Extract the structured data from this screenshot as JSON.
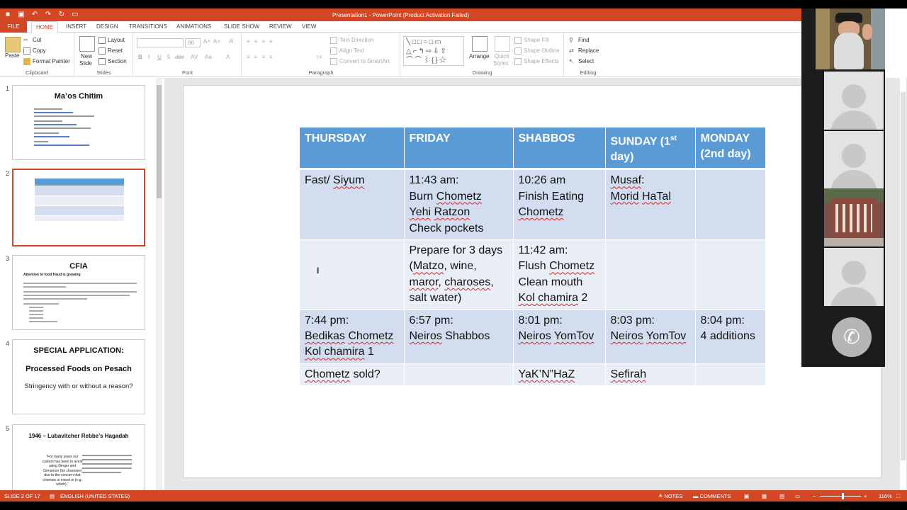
{
  "window": {
    "title": "Presentation1 - PowerPoint (Product Activation Failed)"
  },
  "tabs": [
    "FILE",
    "HOME",
    "INSERT",
    "DESIGN",
    "TRANSITIONS",
    "ANIMATIONS",
    "SLIDE SHOW",
    "REVIEW",
    "VIEW"
  ],
  "active_tab": "HOME",
  "ribbon": {
    "clipboard": {
      "paste": "Paste",
      "cut": "Cut",
      "copy": "Copy",
      "format_painter": "Format Painter",
      "label": "Clipboard"
    },
    "slides": {
      "new_slide_1": "New",
      "new_slide_2": "Slide",
      "layout": "Layout",
      "reset": "Reset",
      "section": "Section",
      "label": "Slides"
    },
    "font": {
      "font_size": "66",
      "label": "Font"
    },
    "paragraph": {
      "text_direction": "Text Direction",
      "align_text": "Align Text",
      "convert_smartart": "Convert to SmartArt",
      "label": "Paragraph"
    },
    "drawing": {
      "arrange": "Arrange",
      "quick_styles_1": "Quick",
      "quick_styles_2": "Styles",
      "shape_fill": "Shape Fill",
      "shape_outline": "Shape Outline",
      "shape_effects": "Shape Effects",
      "label": "Drawing"
    },
    "editing": {
      "find": "Find",
      "replace": "Replace",
      "select": "Select",
      "label": "Editing"
    }
  },
  "thumbnails": [
    {
      "num": "1",
      "title": "Ma’os Chitim"
    },
    {
      "num": "2",
      "title": ""
    },
    {
      "num": "3",
      "title": "CFIA",
      "subtitle": "Attention to food fraud is growing"
    },
    {
      "num": "4",
      "title": "SPECIAL APPLICATION:",
      "line2": "Processed Foods on Pesach",
      "line3": "Stringency with or without a reason?"
    },
    {
      "num": "5",
      "title": "1946 – Lubavitcher Rebbe’s Hagadah",
      "quote": "“For many years our custom has been to avoid using Ginger and Cinnamon (for charoses) due to the concern that chometz is mixed in (e.g. which).”"
    }
  ],
  "table": {
    "headers": [
      "THURSDAY",
      "FRIDAY",
      "SHABBOS",
      "SUNDAY (1st day)",
      "MONDAY (2nd day)"
    ],
    "rows": [
      [
        "Fast/ Siyum",
        "11:43 am: Burn Chometz Yehi Ratzon Check pockets",
        "10:26 am Finish Eating Chometz",
        "Musaf: Morid HaTal",
        ""
      ],
      [
        "",
        "Prepare for 3 days (Matzo, wine, maror, charoses, salt water)",
        "11:42 am: Flush Chometz Clean mouth Kol chamira 2",
        "",
        ""
      ],
      [
        "7:44 pm: Bedikas Chometz Kol chamira 1",
        "6:57 pm: Neiros Shabbos",
        "8:01 pm: Neiros YomTov",
        "8:03 pm: Neiros YomTov",
        "8:04 pm: 4 additions"
      ],
      [
        "Chometz sold?",
        "",
        "YaK’N”HaZ",
        "Sefirah",
        ""
      ]
    ]
  },
  "statusbar": {
    "slide_info": "SLIDE 2 OF 17",
    "language": "ENGLISH (UNITED STATES)",
    "notes": "NOTES",
    "comments": "COMMENTS",
    "zoom": "116%"
  },
  "colors": {
    "accent": "#d24726",
    "table_header": "#5b9bd5",
    "table_row_dark": "#d2deef",
    "table_row_light": "#eaeff7"
  }
}
